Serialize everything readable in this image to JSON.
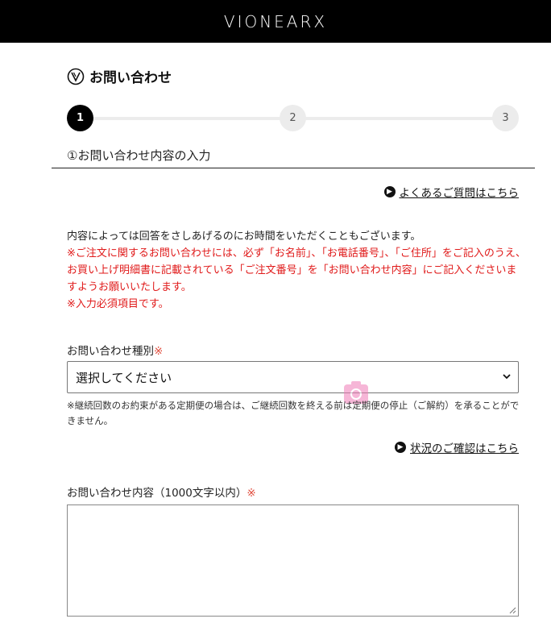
{
  "header": {
    "logo": "VIONEARX"
  },
  "page": {
    "title": "お問い合わせ"
  },
  "stepper": {
    "steps": [
      "1",
      "2",
      "3"
    ],
    "current": 1,
    "heading": "①お問い合わせ内容の入力"
  },
  "links": {
    "faq": "よくあるご質問はこちら",
    "status": "状況のご確認はこちら"
  },
  "info": {
    "line1": "内容によっては回答をさしあげるのにお時間をいただくこともございます。",
    "red1": "※ご注文に関するお問い合わせには、必ず「お名前」、「お電話番号」、「ご住所」をご記入のうえ、お買い上げ明細書に記載されている「ご注文番号」を「お問い合わせ内容」にご記入くださいますようお願いいたします。",
    "red2": "※入力必須項目です。"
  },
  "form": {
    "type_label": "お問い合わせ種別",
    "required_mark": "※",
    "select_value": "選択してください",
    "note": "※継続回数のお約束がある定期便の場合は、ご継続回数を終える前は定期便の停止（ご解約）を承ることができません。",
    "content_label": "お問い合わせ内容（1000文字以内）"
  },
  "colors": {
    "header_bg": "#000000",
    "required": "#e04b3b",
    "notice": "#e01a1a"
  }
}
